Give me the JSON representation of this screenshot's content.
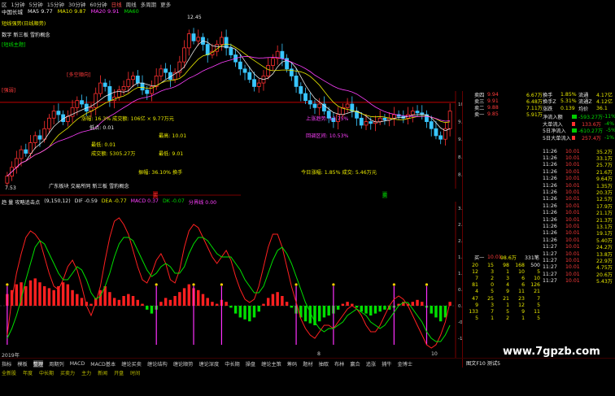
{
  "toolbar": {
    "items": [
      "区 ",
      "1分钟",
      "5分钟",
      "15分钟",
      "30分钟",
      "60分钟",
      "日线",
      "周线",
      "多周期",
      "更多"
    ],
    "selected": "日线"
  },
  "info": {
    "stock": "中国长城",
    "ma5": "MA5 9.77",
    "ma10": "MA10 9.87",
    "ma20": "MA20 9.91",
    "ma60": "MA60",
    "high_price": "12.45"
  },
  "left_labels": {
    "indicator": "短线强势(日线顺势)",
    "concept1": "数字 新三板 雪豹概念",
    "tag_green": "[短线主题]",
    "tag_red": "[多空顺向]",
    "tag_red2": "[强弱]",
    "low_price": "7.53"
  },
  "overlay": {
    "line1": "涨幅: 16.3% 成交额: 106亿 × 9.77万元",
    "line2": "低点: 0.01",
    "line3": "最高: 10.01",
    "line4": "最低: 0.01",
    "line5": "成交额: 5305.27万",
    "line6": "最低: 9.01",
    "line7": "振幅: 36.10% 换手",
    "line8": "今日涨幅: 1.85% 成交: 5.46万元",
    "footer": "广东板块 交易所同 新三板 雪豹概念",
    "buy": "买",
    "sell": "卖",
    "trend1": "上涨趋势: 13.75%",
    "trend2": "回调区间: 10.53%"
  },
  "macd": {
    "title": "趋 量 攻略追击点",
    "params": "(9,150,12)",
    "dif": "DIF -0.59",
    "dea": "DEA -0.77",
    "macd": "MACD 0.37",
    "dk": "DK -0.07",
    "sell_signal": "分界线 0.00"
  },
  "yaxis_main": [
    "10.00",
    "9.50",
    "9.00",
    "8.50",
    "8.00"
  ],
  "yaxis_macd": [
    "3.00",
    "2.50",
    "2.00",
    "1.50",
    "1.00",
    "0.50",
    "0.00",
    "-0.50",
    "-1.00"
  ],
  "xaxis": {
    "start": "2019年",
    "mid": "8",
    "end": "10"
  },
  "bottom_tabs": [
    "指标",
    "模板",
    "整理",
    "周期列",
    "MACD",
    "MACD基本",
    "缠论买卖",
    "缠论结构",
    "缠论顺势",
    "缠论深度",
    "中长期",
    "操盘",
    "缠论主策",
    "筹码",
    "题材",
    "抽取",
    "布林",
    "赢合",
    "追涨",
    "捕牛",
    "金博士"
  ],
  "status": [
    "全新股",
    "年度",
    "中长期",
    "买卖力",
    "主力",
    "新闻",
    "开盘",
    "时间"
  ],
  "right_panel": {
    "sell_rows": [
      {
        "label": "卖四",
        "price": "9.94",
        "vol": "6.67万"
      },
      {
        "label": "卖三",
        "price": "9.91",
        "vol": "6.48万"
      },
      {
        "label": "卖二",
        "price": "9.88",
        "vol": "7.11万"
      },
      {
        "label": "卖一",
        "price": "9.85",
        "vol": "5.91万"
      }
    ],
    "stats": [
      {
        "k": "换手",
        "v": "1.85%",
        "k2": "流通",
        "v2": "4.17亿"
      },
      {
        "k": "换手Z",
        "v": "5.31%",
        "k2": "流通Z",
        "v2": "4.12亿"
      },
      {
        "k": "涨跌",
        "v": "0.139",
        "k2": "均价",
        "v2": "36.1"
      }
    ],
    "flows": [
      {
        "k": "净流入额",
        "v": "-593.27万",
        "p": "-11%"
      },
      {
        "k": "大单流入",
        "v": "133.6万",
        "p": "-4%"
      },
      {
        "k": "5日净流入",
        "v": "-610.27万",
        "p": "-5%"
      },
      {
        "k": "5日大单流入",
        "v": "257.4万",
        "p": "-1%"
      }
    ],
    "ticks": [
      {
        "t": "11:26",
        "p": "10.01",
        "v": "35.2万"
      },
      {
        "t": "11:26",
        "p": "10.01",
        "v": "33.1万"
      },
      {
        "t": "11:26",
        "p": "10.01",
        "v": "25.7万"
      },
      {
        "t": "11:26",
        "p": "10.01",
        "v": "21.6万"
      },
      {
        "t": "11:26",
        "p": "10.01",
        "v": "9.64万"
      },
      {
        "t": "11:26",
        "p": "10.01",
        "v": "1.35万"
      },
      {
        "t": "11:26",
        "p": "10.01",
        "v": "20.3万"
      },
      {
        "t": "11:26",
        "p": "10.01",
        "v": "12.5万"
      },
      {
        "t": "11:26",
        "p": "10.01",
        "v": "17.9万"
      },
      {
        "t": "11:26",
        "p": "10.01",
        "v": "21.1万"
      },
      {
        "t": "11:26",
        "p": "10.01",
        "v": "21.3万"
      },
      {
        "t": "11:26",
        "p": "10.01",
        "v": "13.1万"
      },
      {
        "t": "11:26",
        "p": "10.01",
        "v": "19.1万"
      },
      {
        "t": "11:26",
        "p": "10.01",
        "v": "5.40万"
      },
      {
        "t": "11:27",
        "p": "10.01",
        "v": "24.2万"
      },
      {
        "t": "11:27",
        "p": "10.01",
        "v": "13.8万"
      },
      {
        "t": "11:27",
        "p": "10.01",
        "v": "22.9万"
      },
      {
        "t": "11:27",
        "p": "10.01",
        "v": "4.75万"
      },
      {
        "t": "11:27",
        "p": "10.01",
        "v": "20.6万"
      },
      {
        "t": "11:27",
        "p": "10.01",
        "v": "5.43万"
      }
    ],
    "buy_header": {
      "label": "买一",
      "p": "10.01",
      "v": "98.6万",
      "n": "331笔"
    },
    "queue": [
      [
        "20",
        "15",
        "98",
        "168",
        "500"
      ],
      [
        "12",
        "3",
        "1",
        "10",
        "5"
      ],
      [
        "7",
        "2",
        "3",
        "6",
        "10"
      ],
      [
        "81",
        "0",
        "4",
        "6",
        "126"
      ],
      [
        "4",
        "5",
        "9",
        "11",
        "21"
      ],
      [
        "47",
        "25",
        "21",
        "23",
        "7"
      ],
      [
        "9",
        "3",
        "1",
        "12",
        "5"
      ],
      [
        "133",
        "7",
        "5",
        "9",
        "11"
      ],
      [
        "5",
        "1",
        "2",
        "1",
        "5"
      ]
    ],
    "hint": "图文F10 测试5"
  },
  "watermark": "www.7gpzb.com",
  "chart_data": {
    "type": "candlestick",
    "ylim": [
      7.5,
      12.5
    ],
    "close": [
      7.95,
      8.2,
      8.45,
      8.7,
      8.6,
      8.9,
      9.1,
      9.0,
      9.3,
      9.6,
      9.8,
      9.7,
      9.5,
      9.65,
      9.9,
      10.1,
      10.0,
      9.8,
      9.9,
      10.3,
      10.6,
      10.5,
      10.1,
      10.2,
      10.4,
      10.5,
      10.7,
      10.8,
      10.6,
      10.4,
      10.3,
      10.5,
      10.8,
      11.0,
      10.9,
      10.7,
      10.9,
      11.2,
      11.6,
      12.0,
      11.8,
      11.9,
      11.7,
      11.4,
      11.5,
      11.7,
      11.9,
      11.6,
      11.4,
      11.2,
      11.0,
      10.9,
      10.7,
      10.5,
      10.6,
      10.8,
      11.1,
      11.3,
      11.5,
      11.3,
      11.0,
      10.8,
      10.5,
      10.3,
      10.1,
      10.0,
      9.9,
      10.0,
      9.8,
      9.6,
      9.5,
      9.7,
      9.9,
      10.0,
      9.8,
      9.6,
      9.4,
      9.5,
      9.45,
      9.5,
      9.6,
      9.55,
      9.6,
      9.7,
      9.65,
      9.6,
      9.7,
      9.8,
      9.75,
      9.7,
      9.5,
      9.3,
      9.1,
      9.0,
      9.3,
      9.8
    ],
    "macd_hist": [
      0.3,
      0.4,
      0.55,
      0.6,
      0.5,
      0.65,
      0.7,
      0.6,
      0.5,
      0.45,
      0.4,
      0.5,
      0.6,
      0.55,
      0.4,
      0.3,
      0.2,
      0.1,
      0.05,
      0.2,
      0.4,
      0.5,
      0.35,
      0.2,
      0.15,
      0.25,
      0.3,
      0.25,
      0.15,
      0.05,
      -0.1,
      -0.2,
      -0.1,
      0.1,
      0.2,
      0.15,
      0.25,
      0.35,
      0.45,
      0.55,
      0.45,
      0.4,
      0.3,
      0.2,
      0.1,
      0.05,
      0.15,
      0.1,
      -0.05,
      -0.2,
      -0.3,
      -0.35,
      -0.4,
      -0.3,
      -0.15,
      0.05,
      0.2,
      0.3,
      0.35,
      0.25,
      0.1,
      -0.05,
      -0.2,
      -0.3,
      -0.4,
      -0.45,
      -0.5,
      -0.4,
      -0.3,
      -0.25,
      -0.2,
      -0.1,
      0.05,
      0.1,
      0.05,
      -0.05,
      -0.15,
      -0.2,
      -0.25,
      -0.2,
      -0.15,
      -0.1,
      -0.1,
      -0.05,
      0.05,
      0.1,
      0.05,
      0.1,
      0.15,
      0.1,
      -0.05,
      -0.2,
      -0.3,
      -0.4,
      -0.3,
      0.1
    ],
    "dif": [
      -0.9,
      0.2,
      1.0,
      1.6,
      2.1,
      2.3,
      2.2,
      2.0,
      1.5,
      1.0,
      0.6,
      0.5,
      0.8,
      1.2,
      1.4,
      1.1,
      0.6,
      0.0,
      -0.3,
      0.1,
      0.6,
      1.4,
      2.1,
      2.6,
      2.7,
      2.5,
      2.2,
      1.7,
      1.2,
      0.8,
      0.7,
      1.0,
      1.4,
      1.6,
      1.3,
      0.8,
      0.7,
      1.1,
      1.8,
      2.3,
      2.5,
      2.4,
      2.1,
      1.8,
      1.5,
      1.3,
      1.5,
      1.7,
      1.4,
      0.9,
      0.5,
      0.2,
      0.1,
      0.2,
      0.6,
      1.2,
      1.8,
      2.2,
      2.2,
      1.8,
      1.2,
      0.6,
      0.1,
      -0.4,
      -0.7,
      -0.9,
      -1.0,
      -0.8,
      -0.6,
      -0.6,
      -0.7,
      -0.5,
      -0.3,
      -0.1,
      0.0,
      -0.1,
      -0.3,
      -0.6,
      -0.8,
      -0.8,
      -0.6,
      -0.3,
      0.0,
      0.2,
      0.3,
      0.2,
      0.0,
      -0.3,
      -0.6,
      -0.9,
      -1.2,
      -1.3,
      -1.2,
      -0.9,
      -0.5,
      0.1
    ],
    "dea": [
      -1.0,
      -0.7,
      -0.3,
      0.2,
      0.8,
      1.3,
      1.8,
      2.0,
      1.9,
      1.6,
      1.3,
      1.0,
      0.8,
      0.8,
      1.0,
      1.2,
      1.1,
      0.8,
      0.4,
      0.2,
      0.3,
      0.6,
      1.0,
      1.5,
      1.9,
      2.1,
      2.1,
      2.0,
      1.7,
      1.4,
      1.1,
      0.9,
      1.0,
      1.2,
      1.3,
      1.2,
      1.0,
      1.0,
      1.2,
      1.6,
      1.9,
      2.1,
      2.1,
      2.0,
      1.8,
      1.6,
      1.5,
      1.5,
      1.5,
      1.3,
      1.1,
      0.8,
      0.6,
      0.4,
      0.4,
      0.6,
      1.0,
      1.4,
      1.7,
      1.8,
      1.6,
      1.3,
      0.9,
      0.5,
      0.1,
      -0.2,
      -0.5,
      -0.7,
      -0.8,
      -0.7,
      -0.7,
      -0.6,
      -0.5,
      -0.3,
      -0.2,
      -0.1,
      -0.2,
      -0.3,
      -0.5,
      -0.6,
      -0.7,
      -0.6,
      -0.4,
      -0.2,
      0.0,
      0.1,
      0.1,
      -0.1,
      -0.3,
      -0.5,
      -0.8,
      -1.0,
      -1.1,
      -1.1,
      -0.9,
      -0.6
    ]
  }
}
